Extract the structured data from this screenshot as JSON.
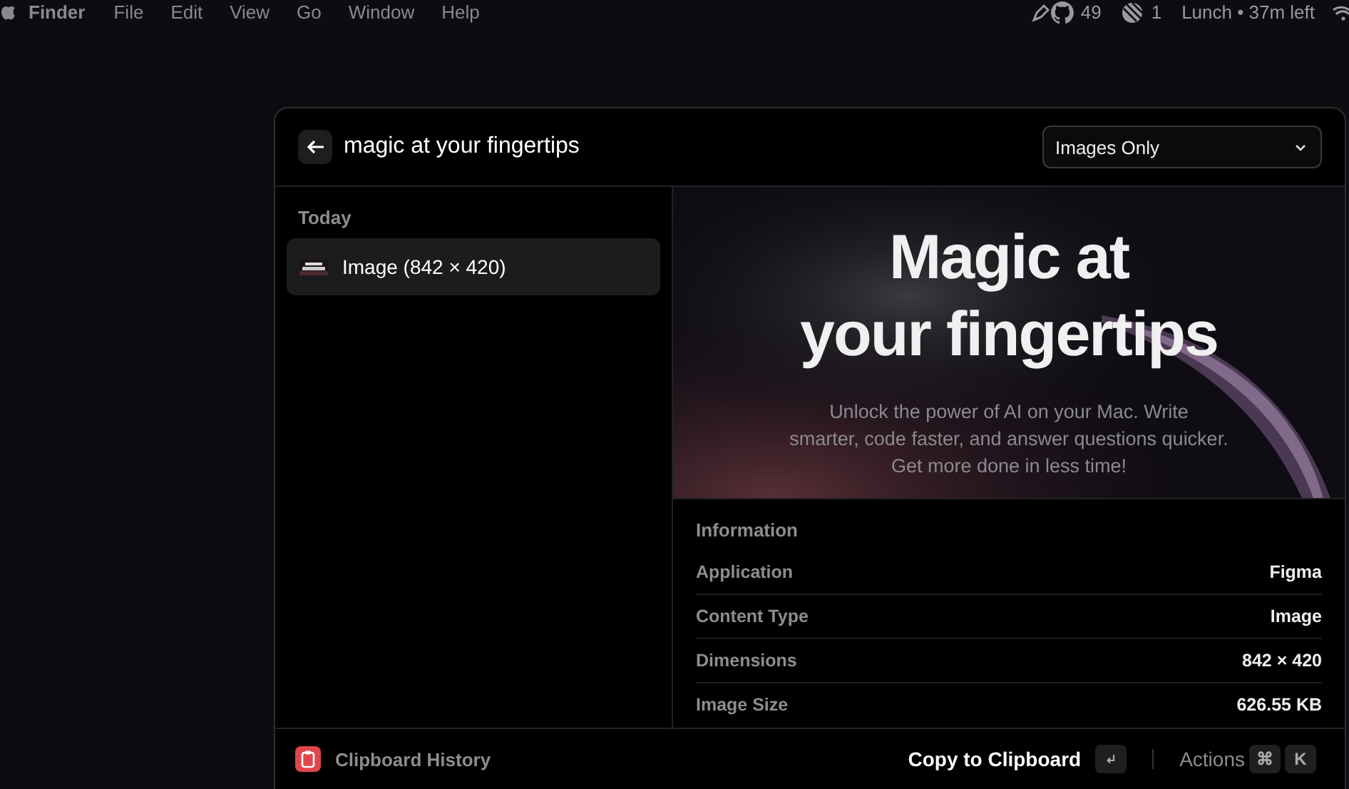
{
  "menu_bar": {
    "items": [
      "Finder",
      "File",
      "Edit",
      "View",
      "Go",
      "Window",
      "Help"
    ],
    "status": {
      "github_count": "49",
      "notification_count": "1",
      "event": "Lunch • 37m left"
    }
  },
  "search": {
    "value": "magic at your fingertips",
    "filter": "Images Only"
  },
  "list": {
    "section": "Today",
    "items": [
      {
        "label": "Image (842 × 420)",
        "selected": true
      }
    ]
  },
  "preview": {
    "kind": "picture",
    "title_lines": [
      "Magic at",
      "your fingertips"
    ],
    "body_lines": [
      "Unlock the power of AI on your Mac. Write",
      "smarter, code faster, and answer questions quicker.",
      "Get more done in less time!"
    ]
  },
  "information": {
    "heading": "Information",
    "rows": [
      {
        "label": "Application",
        "value": "Figma"
      },
      {
        "label": "Content Type",
        "value": "Image"
      },
      {
        "label": "Dimensions",
        "value": "842 × 420"
      },
      {
        "label": "Image Size",
        "value": "626.55 KB"
      }
    ]
  },
  "footer": {
    "title": "Clipboard History",
    "primary_action": "Copy to Clipboard",
    "secondary_action": "Actions",
    "shortcut_keys": [
      "⌘",
      "K"
    ]
  }
}
